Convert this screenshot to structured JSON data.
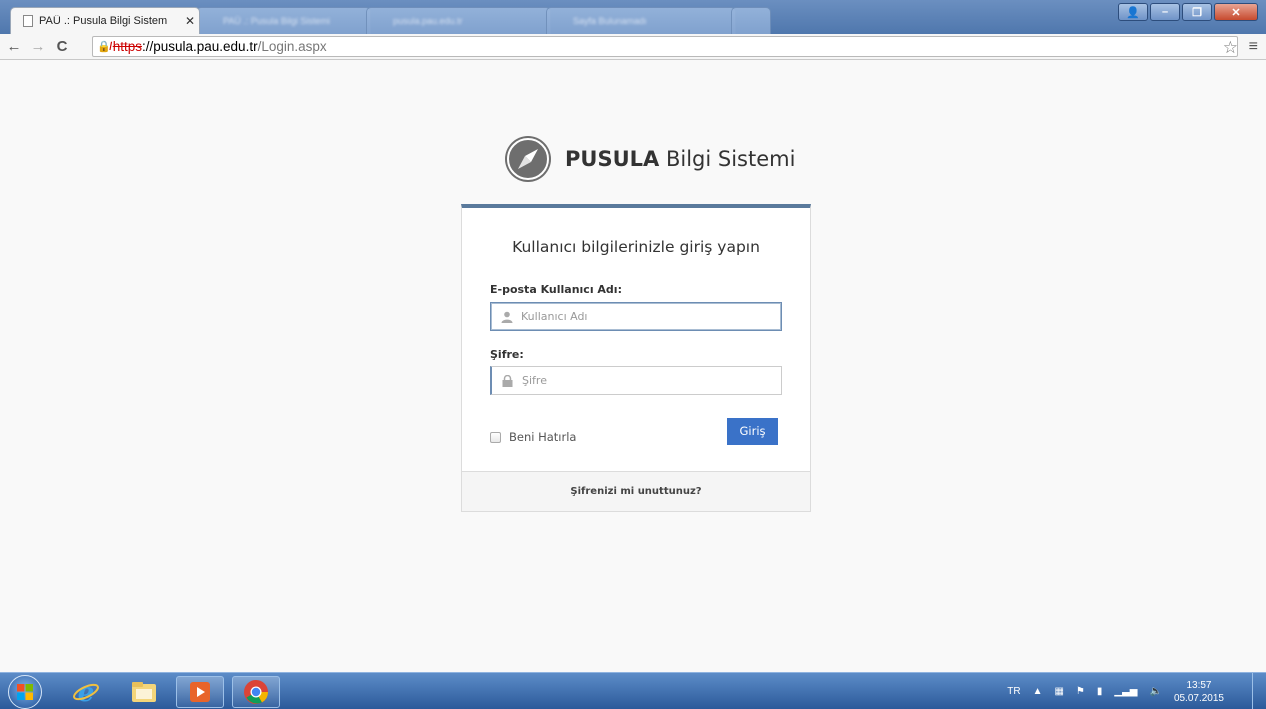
{
  "browser": {
    "active_tab_title": "PAÜ .: Pusula Bilgi Sistem",
    "bg_tabs": [
      "PAÜ .: Pusula Bilgi Sistemi",
      "pusula.pau.edu.tr",
      "Sayfa Bulunamadı"
    ],
    "url_scheme": "https",
    "url_host": "://pusula.pau.edu.tr",
    "url_path": "/Login.aspx"
  },
  "logo": {
    "brand_bold": "PUSULA",
    "brand_rest": "Bilgi Sistemi"
  },
  "login": {
    "heading": "Kullanıcı bilgilerinizle giriş yapın",
    "username_label": "E-posta Kullanıcı Adı:",
    "username_placeholder": "Kullanıcı Adı",
    "password_label": "Şifre:",
    "password_placeholder": "Şifre",
    "remember_label": "Beni Hatırla",
    "submit_label": "Giriş",
    "forgot_label": "Şifrenizi mi unuttunuz?"
  },
  "taskbar": {
    "language": "TR",
    "time": "13:57",
    "date": "05.07.2015"
  },
  "colors": {
    "accent": "#3a72c8",
    "card_top": "#5a7a9c"
  }
}
